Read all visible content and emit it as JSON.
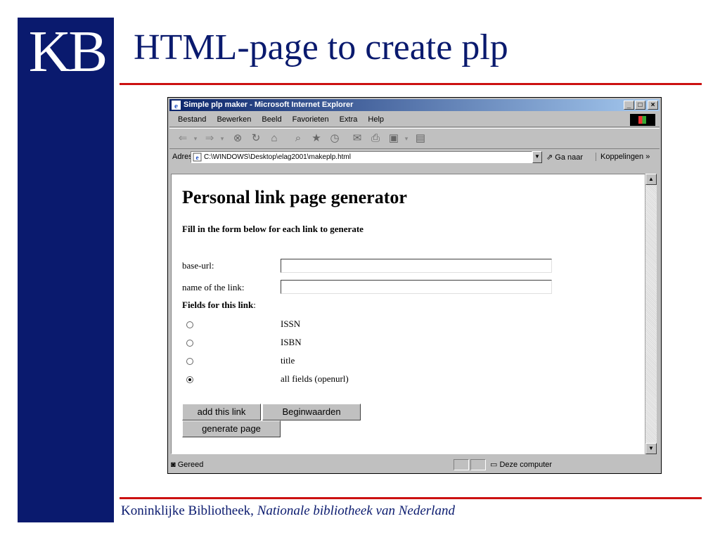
{
  "slide": {
    "logo": "KB",
    "title": "HTML-page to create plp",
    "footer_main": "Koninklijke Bibliotheek, ",
    "footer_italic": "Nationale bibliotheek van Nederland",
    "colors": {
      "navy": "#0a1a6e",
      "rule": "#cc1111"
    }
  },
  "window": {
    "title": "Simple plp maker - Microsoft Internet Explorer",
    "controls": {
      "minimize": "_",
      "maximize": "□",
      "close": "×"
    },
    "menu": [
      "Bestand",
      "Bewerken",
      "Beeld",
      "Favorieten",
      "Extra",
      "Help"
    ],
    "toolbar_icons": [
      "back-icon",
      "forward-icon",
      "stop-icon",
      "refresh-icon",
      "home-icon",
      "search-icon",
      "favorites-icon",
      "history-icon",
      "mail-icon",
      "print-icon",
      "edit-icon",
      "discuss-icon"
    ],
    "address": {
      "label": "Adres",
      "value": "C:\\WINDOWS\\Desktop\\elag2001\\makeplp.html",
      "go": "Ga naar",
      "links": "Koppelingen »"
    },
    "status": {
      "text": "Gereed",
      "zone": "Deze computer"
    }
  },
  "page": {
    "heading": "Personal link page generator",
    "intro": "Fill in the form below for each link to generate",
    "fields": [
      {
        "label": "base-url:",
        "value": ""
      },
      {
        "label": "name of the link:",
        "value": ""
      }
    ],
    "fields_header": "Fields for this link",
    "fields_header_suffix": ":",
    "options": [
      {
        "label": "ISSN",
        "checked": false
      },
      {
        "label": "ISBN",
        "checked": false
      },
      {
        "label": "title",
        "checked": false
      },
      {
        "label": "all fields (openurl)",
        "checked": true
      }
    ],
    "buttons": {
      "add": "add this link",
      "reset": "Beginwaarden",
      "generate": "generate page"
    }
  }
}
